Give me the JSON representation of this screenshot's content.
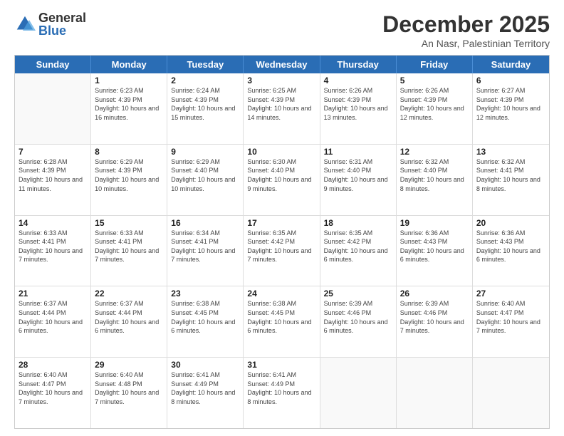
{
  "logo": {
    "general": "General",
    "blue": "Blue"
  },
  "title": "December 2025",
  "subtitle": "An Nasr, Palestinian Territory",
  "header_days": [
    "Sunday",
    "Monday",
    "Tuesday",
    "Wednesday",
    "Thursday",
    "Friday",
    "Saturday"
  ],
  "weeks": [
    [
      {
        "day": "",
        "sunrise": "",
        "sunset": "",
        "daylight": "",
        "empty": true
      },
      {
        "day": "1",
        "sunrise": "Sunrise: 6:23 AM",
        "sunset": "Sunset: 4:39 PM",
        "daylight": "Daylight: 10 hours and 16 minutes."
      },
      {
        "day": "2",
        "sunrise": "Sunrise: 6:24 AM",
        "sunset": "Sunset: 4:39 PM",
        "daylight": "Daylight: 10 hours and 15 minutes."
      },
      {
        "day": "3",
        "sunrise": "Sunrise: 6:25 AM",
        "sunset": "Sunset: 4:39 PM",
        "daylight": "Daylight: 10 hours and 14 minutes."
      },
      {
        "day": "4",
        "sunrise": "Sunrise: 6:26 AM",
        "sunset": "Sunset: 4:39 PM",
        "daylight": "Daylight: 10 hours and 13 minutes."
      },
      {
        "day": "5",
        "sunrise": "Sunrise: 6:26 AM",
        "sunset": "Sunset: 4:39 PM",
        "daylight": "Daylight: 10 hours and 12 minutes."
      },
      {
        "day": "6",
        "sunrise": "Sunrise: 6:27 AM",
        "sunset": "Sunset: 4:39 PM",
        "daylight": "Daylight: 10 hours and 12 minutes."
      }
    ],
    [
      {
        "day": "7",
        "sunrise": "Sunrise: 6:28 AM",
        "sunset": "Sunset: 4:39 PM",
        "daylight": "Daylight: 10 hours and 11 minutes."
      },
      {
        "day": "8",
        "sunrise": "Sunrise: 6:29 AM",
        "sunset": "Sunset: 4:39 PM",
        "daylight": "Daylight: 10 hours and 10 minutes."
      },
      {
        "day": "9",
        "sunrise": "Sunrise: 6:29 AM",
        "sunset": "Sunset: 4:40 PM",
        "daylight": "Daylight: 10 hours and 10 minutes."
      },
      {
        "day": "10",
        "sunrise": "Sunrise: 6:30 AM",
        "sunset": "Sunset: 4:40 PM",
        "daylight": "Daylight: 10 hours and 9 minutes."
      },
      {
        "day": "11",
        "sunrise": "Sunrise: 6:31 AM",
        "sunset": "Sunset: 4:40 PM",
        "daylight": "Daylight: 10 hours and 9 minutes."
      },
      {
        "day": "12",
        "sunrise": "Sunrise: 6:32 AM",
        "sunset": "Sunset: 4:40 PM",
        "daylight": "Daylight: 10 hours and 8 minutes."
      },
      {
        "day": "13",
        "sunrise": "Sunrise: 6:32 AM",
        "sunset": "Sunset: 4:41 PM",
        "daylight": "Daylight: 10 hours and 8 minutes."
      }
    ],
    [
      {
        "day": "14",
        "sunrise": "Sunrise: 6:33 AM",
        "sunset": "Sunset: 4:41 PM",
        "daylight": "Daylight: 10 hours and 7 minutes."
      },
      {
        "day": "15",
        "sunrise": "Sunrise: 6:33 AM",
        "sunset": "Sunset: 4:41 PM",
        "daylight": "Daylight: 10 hours and 7 minutes."
      },
      {
        "day": "16",
        "sunrise": "Sunrise: 6:34 AM",
        "sunset": "Sunset: 4:41 PM",
        "daylight": "Daylight: 10 hours and 7 minutes."
      },
      {
        "day": "17",
        "sunrise": "Sunrise: 6:35 AM",
        "sunset": "Sunset: 4:42 PM",
        "daylight": "Daylight: 10 hours and 7 minutes."
      },
      {
        "day": "18",
        "sunrise": "Sunrise: 6:35 AM",
        "sunset": "Sunset: 4:42 PM",
        "daylight": "Daylight: 10 hours and 6 minutes."
      },
      {
        "day": "19",
        "sunrise": "Sunrise: 6:36 AM",
        "sunset": "Sunset: 4:43 PM",
        "daylight": "Daylight: 10 hours and 6 minutes."
      },
      {
        "day": "20",
        "sunrise": "Sunrise: 6:36 AM",
        "sunset": "Sunset: 4:43 PM",
        "daylight": "Daylight: 10 hours and 6 minutes."
      }
    ],
    [
      {
        "day": "21",
        "sunrise": "Sunrise: 6:37 AM",
        "sunset": "Sunset: 4:44 PM",
        "daylight": "Daylight: 10 hours and 6 minutes."
      },
      {
        "day": "22",
        "sunrise": "Sunrise: 6:37 AM",
        "sunset": "Sunset: 4:44 PM",
        "daylight": "Daylight: 10 hours and 6 minutes."
      },
      {
        "day": "23",
        "sunrise": "Sunrise: 6:38 AM",
        "sunset": "Sunset: 4:45 PM",
        "daylight": "Daylight: 10 hours and 6 minutes."
      },
      {
        "day": "24",
        "sunrise": "Sunrise: 6:38 AM",
        "sunset": "Sunset: 4:45 PM",
        "daylight": "Daylight: 10 hours and 6 minutes."
      },
      {
        "day": "25",
        "sunrise": "Sunrise: 6:39 AM",
        "sunset": "Sunset: 4:46 PM",
        "daylight": "Daylight: 10 hours and 6 minutes."
      },
      {
        "day": "26",
        "sunrise": "Sunrise: 6:39 AM",
        "sunset": "Sunset: 4:46 PM",
        "daylight": "Daylight: 10 hours and 7 minutes."
      },
      {
        "day": "27",
        "sunrise": "Sunrise: 6:40 AM",
        "sunset": "Sunset: 4:47 PM",
        "daylight": "Daylight: 10 hours and 7 minutes."
      }
    ],
    [
      {
        "day": "28",
        "sunrise": "Sunrise: 6:40 AM",
        "sunset": "Sunset: 4:47 PM",
        "daylight": "Daylight: 10 hours and 7 minutes."
      },
      {
        "day": "29",
        "sunrise": "Sunrise: 6:40 AM",
        "sunset": "Sunset: 4:48 PM",
        "daylight": "Daylight: 10 hours and 7 minutes."
      },
      {
        "day": "30",
        "sunrise": "Sunrise: 6:41 AM",
        "sunset": "Sunset: 4:49 PM",
        "daylight": "Daylight: 10 hours and 8 minutes."
      },
      {
        "day": "31",
        "sunrise": "Sunrise: 6:41 AM",
        "sunset": "Sunset: 4:49 PM",
        "daylight": "Daylight: 10 hours and 8 minutes."
      },
      {
        "day": "",
        "sunrise": "",
        "sunset": "",
        "daylight": "",
        "empty": true
      },
      {
        "day": "",
        "sunrise": "",
        "sunset": "",
        "daylight": "",
        "empty": true
      },
      {
        "day": "",
        "sunrise": "",
        "sunset": "",
        "daylight": "",
        "empty": true
      }
    ]
  ]
}
